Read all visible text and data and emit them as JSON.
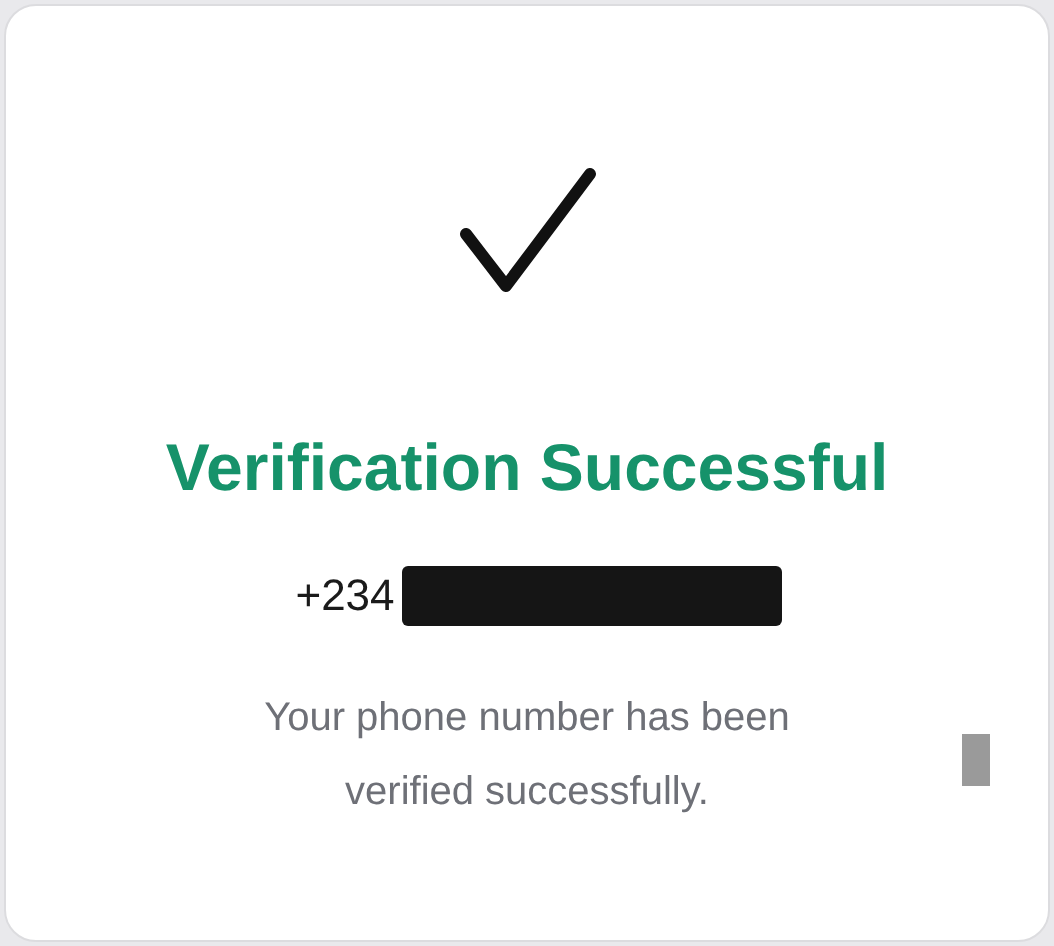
{
  "title": "Verification Successful",
  "phone": {
    "visible": "+234",
    "redacted": true
  },
  "message": "Your phone number has been verified successfully."
}
